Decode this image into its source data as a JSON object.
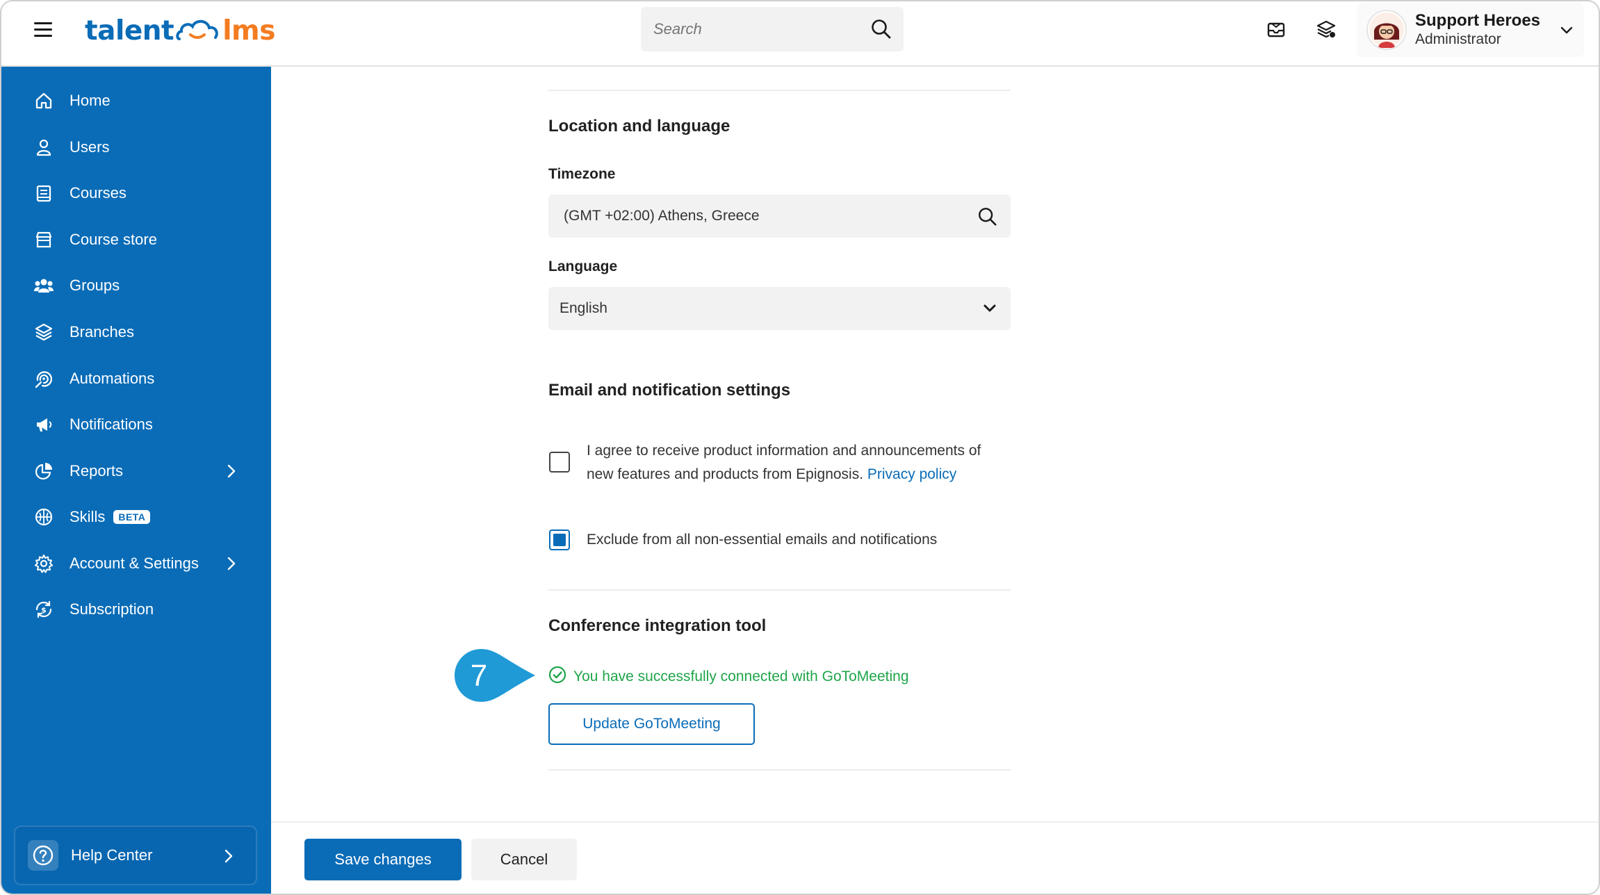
{
  "header": {
    "logo_left": "talent",
    "logo_right": "lms",
    "search_placeholder": "Search",
    "user_name": "Support Heroes",
    "user_role": "Administrator"
  },
  "sidebar": {
    "items": [
      {
        "label": "Home",
        "icon": "home-icon"
      },
      {
        "label": "Users",
        "icon": "user-icon"
      },
      {
        "label": "Courses",
        "icon": "book-icon"
      },
      {
        "label": "Course store",
        "icon": "store-icon"
      },
      {
        "label": "Groups",
        "icon": "groups-icon"
      },
      {
        "label": "Branches",
        "icon": "layers-icon"
      },
      {
        "label": "Automations",
        "icon": "automation-icon"
      },
      {
        "label": "Notifications",
        "icon": "megaphone-icon"
      },
      {
        "label": "Reports",
        "icon": "pie-chart-icon",
        "has_submenu": true
      },
      {
        "label": "Skills",
        "icon": "brain-icon",
        "badge": "BETA"
      },
      {
        "label": "Account & Settings",
        "icon": "gear-icon",
        "has_submenu": true
      },
      {
        "label": "Subscription",
        "icon": "subscription-icon"
      }
    ],
    "help_label": "Help Center"
  },
  "location": {
    "title": "Location and language",
    "timezone_label": "Timezone",
    "timezone_value": "(GMT +02:00) Athens, Greece",
    "language_label": "Language",
    "language_value": "English"
  },
  "email": {
    "title": "Email and notification settings",
    "agree_text_line1": "I agree to receive product information and announcements of",
    "agree_text_line2": "new features and products from Epignosis.",
    "privacy_link": "Privacy policy",
    "agree_checked": false,
    "exclude_text": "Exclude from all non-essential emails and notifications",
    "exclude_checked": true
  },
  "conference": {
    "title": "Conference integration tool",
    "success_text": "You have successfully connected with GoToMeeting",
    "update_button": "Update GoToMeeting"
  },
  "step_badge": "7",
  "footer": {
    "save_label": "Save changes",
    "cancel_label": "Cancel"
  },
  "colors": {
    "brand_blue": "#0a6cb7",
    "brand_orange": "#f47c20",
    "success_green": "#1fa54a",
    "callout_blue": "#1f9ad6"
  }
}
